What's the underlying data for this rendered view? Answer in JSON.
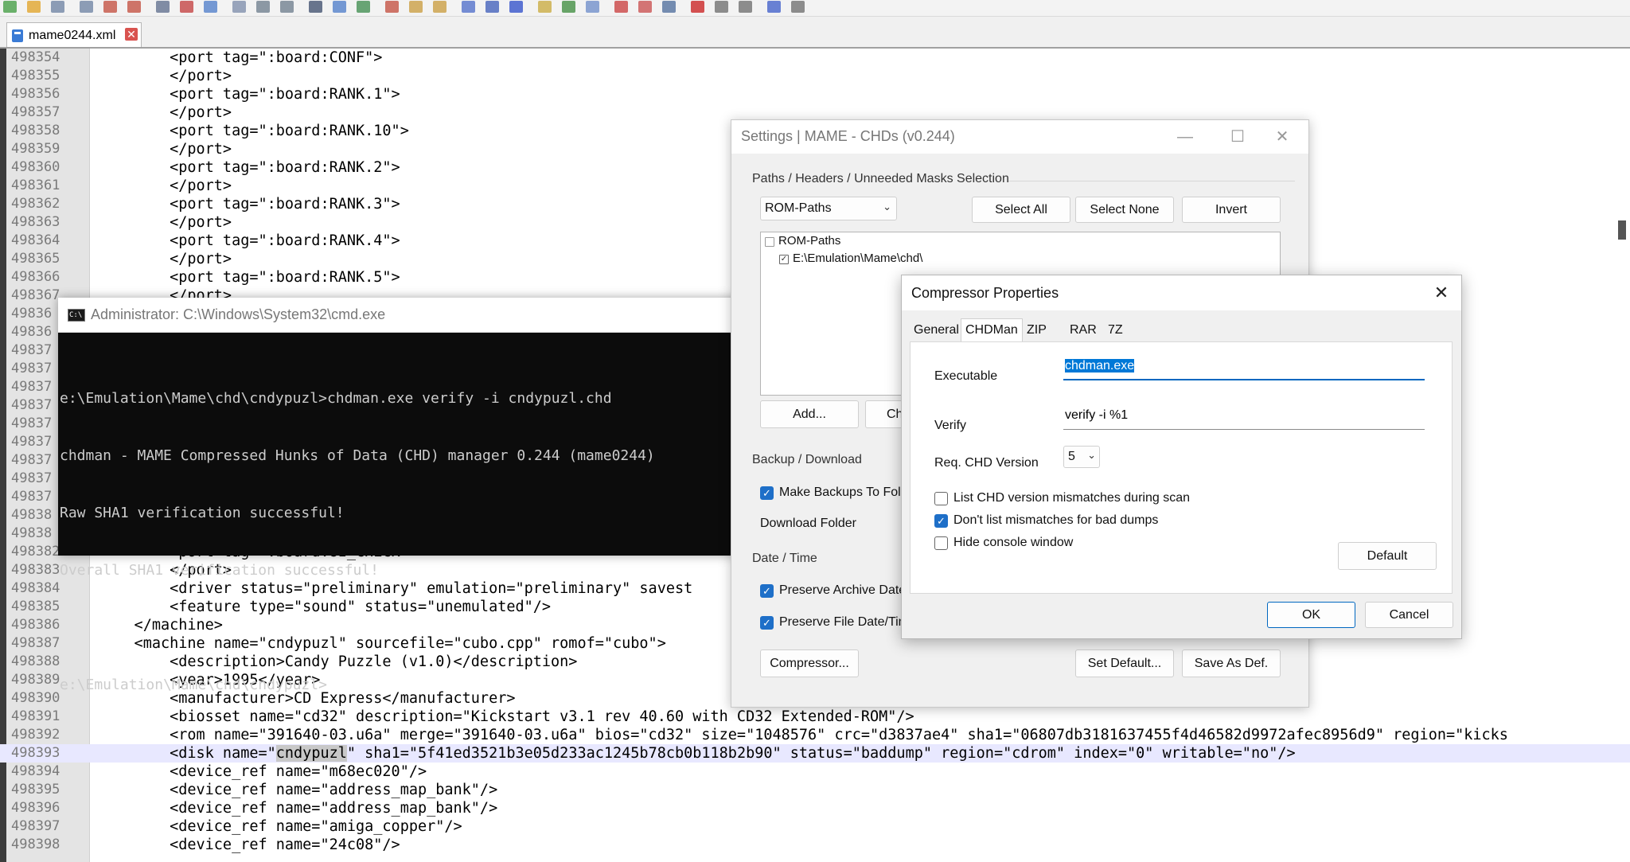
{
  "editor": {
    "tab_label": "mame0244.xml",
    "tab_close": "✕",
    "lines": [
      {
        "n": "498354",
        "t": "        <port tag=\":board:CONF\">"
      },
      {
        "n": "498355",
        "t": "        </port>"
      },
      {
        "n": "498356",
        "t": "        <port tag=\":board:RANK.1\">"
      },
      {
        "n": "498357",
        "t": "        </port>"
      },
      {
        "n": "498358",
        "t": "        <port tag=\":board:RANK.10\">"
      },
      {
        "n": "498359",
        "t": "        </port>"
      },
      {
        "n": "498360",
        "t": "        <port tag=\":board:RANK.2\">"
      },
      {
        "n": "498361",
        "t": "        </port>"
      },
      {
        "n": "498362",
        "t": "        <port tag=\":board:RANK.3\">"
      },
      {
        "n": "498363",
        "t": "        </port>"
      },
      {
        "n": "498364",
        "t": "        <port tag=\":board:RANK.4\">"
      },
      {
        "n": "498365",
        "t": "        </port>"
      },
      {
        "n": "498366",
        "t": "        <port tag=\":board:RANK.5\">"
      },
      {
        "n": "498367",
        "t": "        </port>"
      },
      {
        "n": "49836",
        "t": ""
      },
      {
        "n": "49836",
        "t": ""
      },
      {
        "n": "49837",
        "t": ""
      },
      {
        "n": "49837",
        "t": ""
      },
      {
        "n": "49837",
        "t": ""
      },
      {
        "n": "49837",
        "t": ""
      },
      {
        "n": "49837",
        "t": ""
      },
      {
        "n": "49837",
        "t": ""
      },
      {
        "n": "49837",
        "t": ""
      },
      {
        "n": "49837",
        "t": ""
      },
      {
        "n": "49837",
        "t": ""
      },
      {
        "n": "49838",
        "t": ""
      },
      {
        "n": "49838",
        "t": "        <p"
      },
      {
        "n": "498382",
        "t": "        <port tag=\":board:UI_CHECK\">"
      },
      {
        "n": "498383",
        "t": "        </port>"
      },
      {
        "n": "498384",
        "t": "        <driver status=\"preliminary\" emulation=\"preliminary\" savest"
      },
      {
        "n": "498385",
        "t": "        <feature type=\"sound\" status=\"unemulated\"/>"
      },
      {
        "n": "498386",
        "t": "    </machine>"
      },
      {
        "n": "498387",
        "t": "    <machine name=\"cndypuzl\" sourcefile=\"cubo.cpp\" romof=\"cubo\">"
      },
      {
        "n": "498388",
        "t": "        <description>Candy Puzzle (v1.0)</description>"
      },
      {
        "n": "498389",
        "t": "        <year>1995</year>"
      },
      {
        "n": "498390",
        "t": "        <manufacturer>CD Express</manufacturer>"
      },
      {
        "n": "498391",
        "t": "        <biosset name=\"cd32\" description=\"Kickstart v3.1 rev 40.60 with CD32 Extended-ROM\"/>"
      },
      {
        "n": "498392",
        "t": "        <rom name=\"391640-03.u6a\" merge=\"391640-03.u6a\" bios=\"cd32\" size=\"1048576\" crc=\"d3837ae4\" sha1=\"06807db3181637455f4d46582d9972afec8956d9\" region=\"kicks"
      },
      {
        "n": "498393",
        "t_pre": "        <disk name=\"",
        "t_hl": "cndypuzl",
        "t_post": "\" sha1=\"5f41ed3521b3e05d233ac1245b78cb0b118b2b90\" status=\"baddump\" region=\"cdrom\" index=\"0\" writable=\"no\"/>"
      },
      {
        "n": "498394",
        "t": "        <device_ref name=\"m68ec020\"/>"
      },
      {
        "n": "498395",
        "t": "        <device_ref name=\"address_map_bank\"/>"
      },
      {
        "n": "498396",
        "t": "        <device_ref name=\"address_map_bank\"/>"
      },
      {
        "n": "498397",
        "t": "        <device_ref name=\"amiga_copper\"/>"
      },
      {
        "n": "498398",
        "t": "        <device_ref name=\"24c08\"/>"
      }
    ]
  },
  "cmd": {
    "title": "Administrator: C:\\Windows\\System32\\cmd.exe",
    "icon_text": "C:\\",
    "lines": [
      "e:\\Emulation\\Mame\\chd\\cndypuzl>chdman.exe verify -i cndypuzl.chd",
      "chdman - MAME Compressed Hunks of Data (CHD) manager 0.244 (mame0244)",
      "Raw SHA1 verification successful!",
      "Overall SHA1 verification successful!",
      "",
      "e:\\Emulation\\Mame\\chd\\cndypuzl>"
    ]
  },
  "settings": {
    "title": "Settings | MAME - CHDs (v0.244)",
    "paths_group": "Paths / Headers / Unneeded Masks Selection",
    "path_type_selected": "ROM-Paths",
    "select_all": "Select All",
    "select_none": "Select None",
    "invert": "Invert",
    "tree_root": "ROM-Paths",
    "tree_child": "E:\\Emulation\\Mame\\chd\\",
    "add_button": "Add...",
    "change_button_partial": "Ch",
    "backup_group": "Backup / Download",
    "make_backups": "Make Backups To Fol",
    "download_folder": "Download Folder",
    "datetime_group": "Date / Time",
    "preserve_archive": "Preserve Archive Date",
    "preserve_file": "Preserve File Date/Tim",
    "compressor_button": "Compressor...",
    "set_default": "Set Default...",
    "save_as_def": "Save As Def."
  },
  "compressor": {
    "title": "Compressor Properties",
    "close": "✕",
    "tabs": [
      "General",
      "CHDMan",
      "ZIP",
      "RAR",
      "7Z"
    ],
    "active_tab": "CHDMan",
    "executable_label": "Executable",
    "executable_value": "chdman.exe",
    "verify_label": "Verify",
    "verify_value": "verify -i %1",
    "req_version_label": "Req. CHD Version",
    "req_version_value": "5",
    "opt_list_mismatch": "List CHD version mismatches during scan",
    "opt_dont_list": "Don't list mismatches for bad dumps",
    "opt_hide_console": "Hide console window",
    "default_button": "Default",
    "ok_button": "OK",
    "cancel_button": "Cancel"
  },
  "colors": {
    "accent": "#1e6fc8",
    "cmd_bg": "#0c0c0c",
    "current_line": "#e8e8ff"
  }
}
